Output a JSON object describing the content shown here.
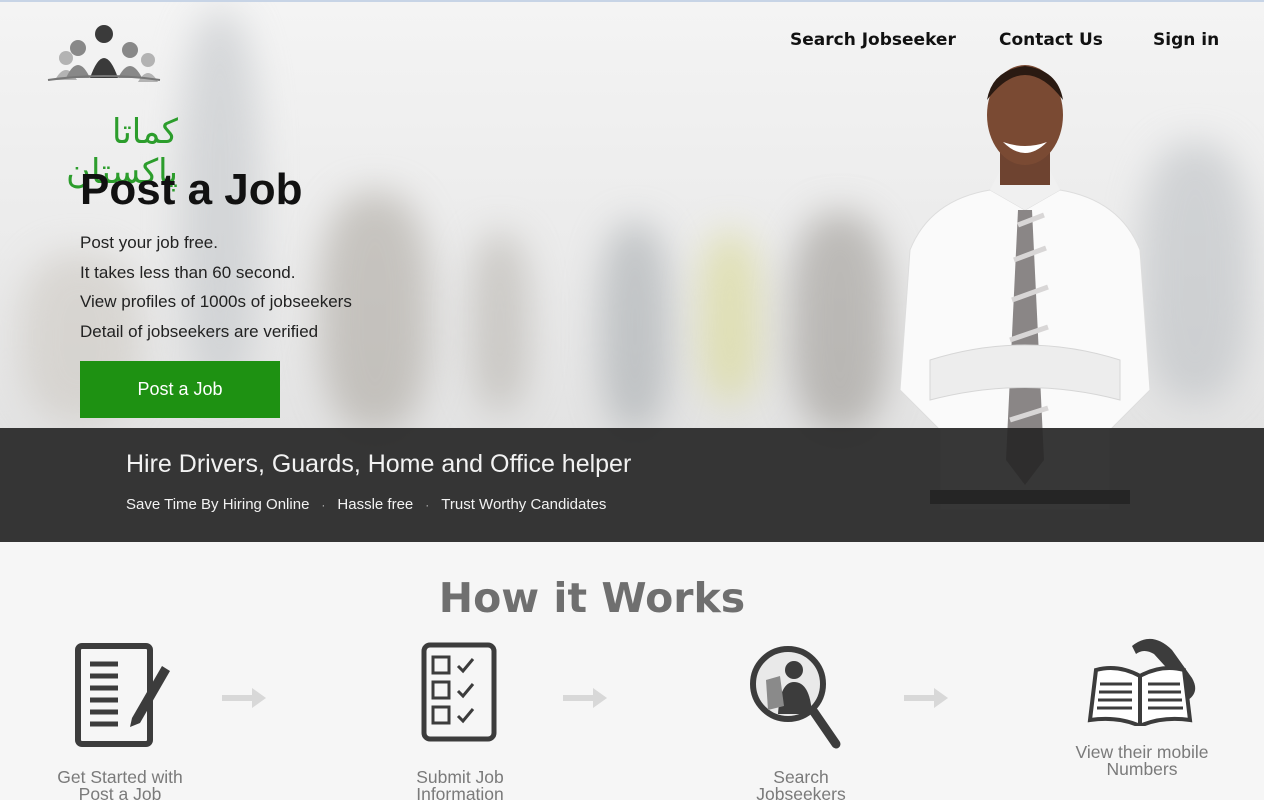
{
  "header": {
    "logo_text": "کماتا پاکستان",
    "nav": {
      "search_jobseeker": "Search Jobseeker",
      "contact_us": "Contact Us",
      "sign_in": "Sign in"
    }
  },
  "hero": {
    "title": "Post a Job",
    "bullets": [
      "Post your job free.",
      "It takes less than 60 second.",
      "View profiles of 1000s of jobseekers",
      "Detail of jobseekers are verified"
    ],
    "cta_label": "Post a Job"
  },
  "banner": {
    "title": "Hire Drivers, Guards, Home and Office helper",
    "tags": [
      "Save Time By Hiring Online",
      "Hassle free",
      "Trust Worthy Candidates"
    ]
  },
  "how_it_works": {
    "title": "How it Works",
    "steps": [
      {
        "icon": "document-pen-icon",
        "label_line1": "Get Started with",
        "label_line2": "Post a Job"
      },
      {
        "icon": "checklist-icon",
        "label_line1": "Submit Job",
        "label_line2": "Information"
      },
      {
        "icon": "magnifier-person-icon",
        "label_line1": "Search",
        "label_line2": "Jobseekers"
      },
      {
        "icon": "phone-book-icon",
        "label_line1": "View their mobile",
        "label_line2": "Numbers"
      }
    ]
  },
  "colors": {
    "brand_green": "#1e9112",
    "logo_green": "#2c9d2c",
    "banner_bg": "#262626",
    "heading_gray": "#6f6f6f"
  }
}
